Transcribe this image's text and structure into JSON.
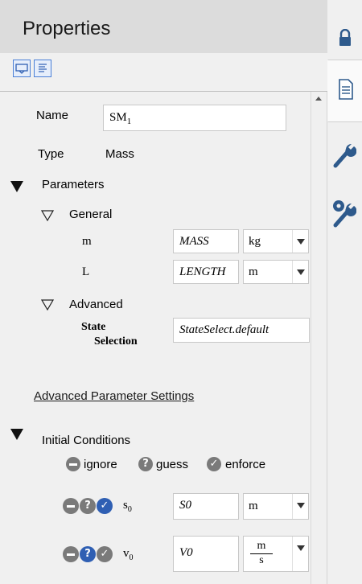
{
  "panel": {
    "title": "Properties"
  },
  "toolbar": {
    "buttons": [
      {
        "name": "expanded-view-icon"
      },
      {
        "name": "text-view-icon"
      }
    ]
  },
  "fields": {
    "name_label": "Name",
    "name_value": "SM",
    "name_subscript": "1",
    "type_label": "Type",
    "type_value": "Mass"
  },
  "parameters": {
    "header": "Parameters",
    "general": {
      "header": "General",
      "rows": [
        {
          "label": "m",
          "value": "MASS",
          "unit": "kg"
        },
        {
          "label": "L",
          "value": "LENGTH",
          "unit": "m"
        }
      ]
    },
    "advanced": {
      "header": "Advanced",
      "state_label_1": "State",
      "state_label_2": "Selection",
      "state_value": "StateSelect.default"
    },
    "advanced_link": "Advanced Parameter Settings"
  },
  "initial_conditions": {
    "header": "Initial Conditions",
    "legend": {
      "ignore": "ignore",
      "guess": "guess",
      "enforce": "enforce"
    },
    "rows": [
      {
        "var": "s",
        "sub": "0",
        "value": "S0",
        "unit": "m",
        "selected": "enforce"
      },
      {
        "var": "v",
        "sub": "0",
        "value": "V0",
        "unit_num": "m",
        "unit_den": "s",
        "selected": "guess"
      }
    ]
  },
  "side_tabs": [
    {
      "name": "lock-icon"
    },
    {
      "name": "document-icon"
    },
    {
      "name": "wrench-icon"
    },
    {
      "name": "settings-wrench-icon"
    }
  ],
  "colors": {
    "title_bar": "#dcdcdc",
    "selected_blue": "#2f5fb3",
    "unselected_gray": "#7a7a7a",
    "tool_icon_blue": "#2e5a8c",
    "border_blue": "#4a7fd6"
  }
}
